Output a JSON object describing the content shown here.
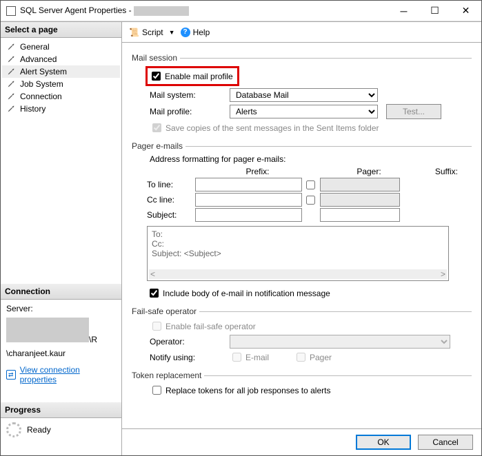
{
  "window": {
    "title_prefix": "SQL Server Agent Properties - "
  },
  "sidebar": {
    "header": "Select a page",
    "items": [
      {
        "label": "General"
      },
      {
        "label": "Advanced"
      },
      {
        "label": "Alert System"
      },
      {
        "label": "Job System"
      },
      {
        "label": "Connection"
      },
      {
        "label": "History"
      }
    ],
    "conn_header": "Connection",
    "server_label": "Server:",
    "server_suffix": "\\R",
    "user_suffix": "\\charanjeet.kaur",
    "view_conn": "View connection properties",
    "progress_header": "Progress",
    "ready": "Ready"
  },
  "toolbar": {
    "script": "Script",
    "help": "Help"
  },
  "mail": {
    "legend": "Mail session",
    "enable": "Enable mail profile",
    "mail_system_label": "Mail system:",
    "mail_system_value": "Database Mail",
    "mail_profile_label": "Mail profile:",
    "mail_profile_value": "Alerts",
    "test": "Test...",
    "save_copies": "Save copies of the sent messages in the Sent Items folder"
  },
  "pager": {
    "legend": "Pager e-mails",
    "addr_fmt": "Address formatting for pager e-mails:",
    "prefix": "Prefix:",
    "pager": "Pager:",
    "suffix": "Suffix:",
    "to": "To line:",
    "cc": "Cc line:",
    "subject": "Subject:",
    "preview_to": "To:",
    "preview_cc": "Cc:",
    "preview_subject": "Subject: <Subject>",
    "include_body": "Include body of e-mail in notification message"
  },
  "failsafe": {
    "legend": "Fail-safe operator",
    "enable": "Enable fail-safe operator",
    "operator": "Operator:",
    "notify": "Notify using:",
    "email": "E-mail",
    "pager": "Pager"
  },
  "token": {
    "legend": "Token replacement",
    "replace": "Replace tokens for all job responses to alerts"
  },
  "footer": {
    "ok": "OK",
    "cancel": "Cancel"
  }
}
